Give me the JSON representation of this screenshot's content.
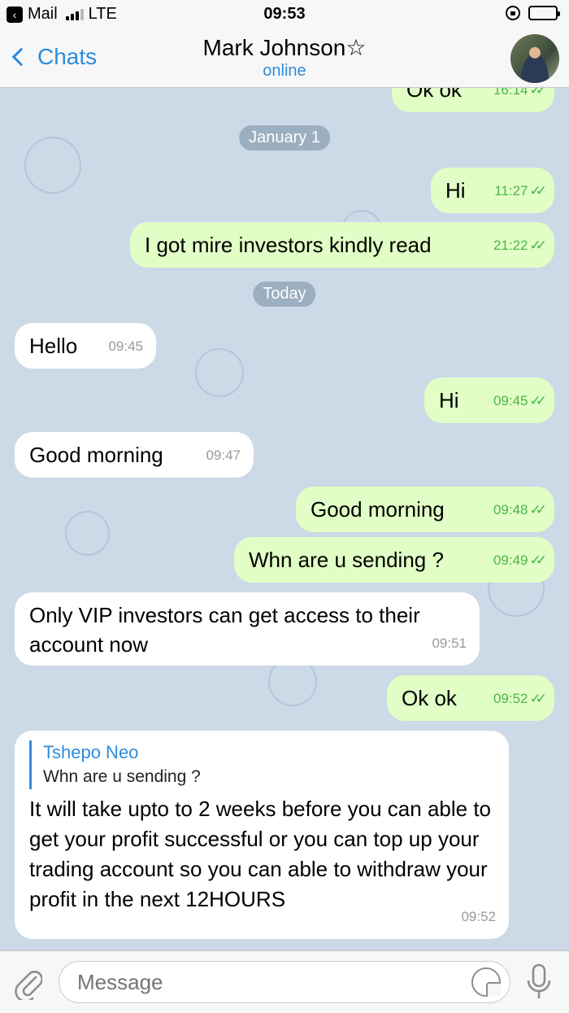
{
  "status_bar": {
    "back_app": "Mail",
    "carrier": "LTE",
    "time": "09:53"
  },
  "nav": {
    "back_label": "Chats",
    "title": "Mark Johnson☆",
    "subtitle": "online"
  },
  "messages": {
    "m0": {
      "text": "Ok ok",
      "time": "16:14",
      "ticks": "✓✓"
    },
    "d1": {
      "label": "January 1"
    },
    "m1": {
      "text": "Hi",
      "time": "11:27",
      "ticks": "✓✓"
    },
    "m2": {
      "text": "I got mire investors kindly read",
      "time": "21:22",
      "ticks": "✓✓"
    },
    "d2": {
      "label": "Today"
    },
    "m3": {
      "text": "Hello",
      "time": "09:45"
    },
    "m4": {
      "text": "Hi",
      "time": "09:45",
      "ticks": "✓✓"
    },
    "m5": {
      "text": "Good morning",
      "time": "09:47"
    },
    "m6": {
      "text": "Good morning",
      "time": "09:48",
      "ticks": "✓✓"
    },
    "m7": {
      "text": "Whn are u sending ?",
      "time": "09:49",
      "ticks": "✓✓"
    },
    "m8": {
      "text": "Only VIP investors can get access to their account now",
      "time": "09:51"
    },
    "m9": {
      "text": "Ok ok",
      "time": "09:52",
      "ticks": "✓✓"
    },
    "m10": {
      "reply_name": "Tshepo Neo",
      "reply_text": "Whn are u sending ?",
      "text": "It will take upto to 2 weeks before you can able to get your profit successful or you can top up your trading account so you can able to withdraw your profit in the next 12HOURS",
      "time": "09:52"
    }
  },
  "input": {
    "placeholder": "Message"
  },
  "colors": {
    "accent": "#2e8cdb",
    "outgoing_bubble": "#e1fec6",
    "incoming_bubble": "#ffffff",
    "check_green": "#4db44a",
    "wallpaper": "#ccd9e6"
  },
  "icons": [
    "back-chevron-icon",
    "signal-icon",
    "rotation-lock-icon",
    "battery-icon",
    "attach-icon",
    "sticker-icon",
    "microphone-icon"
  ]
}
